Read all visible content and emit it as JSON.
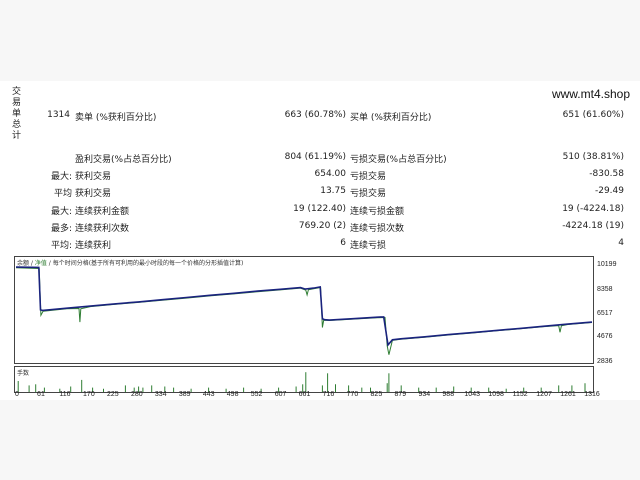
{
  "header": {
    "vertical_title": "交易单总计",
    "site": "www.mt4.shop"
  },
  "stats": {
    "total_trades": "1314",
    "short_label": "卖单 (%获利百分比)",
    "short_value": "663 (60.78%)",
    "long_label": "买单 (%获利百分比)",
    "long_value": "651 (61.60%)",
    "profit_trades_label": "盈利交易(%占总百分比)",
    "profit_trades_value": "804 (61.19%)",
    "loss_trades_label": "亏损交易(%占总百分比)",
    "loss_trades_value": "510 (38.81%)",
    "largest_label": "最大:",
    "largest_profit_label": "获利交易",
    "largest_profit_value": "654.00",
    "largest_loss_label": "亏损交易",
    "largest_loss_value": "-830.58",
    "average_label": "平均",
    "average_profit_label": "获利交易",
    "average_profit_value": "13.75",
    "average_loss_label": "亏损交易",
    "average_loss_value": "-29.49",
    "maximum_label": "最大:",
    "max_consec_win_money_label": "连续获利金额",
    "max_consec_win_money_value": "19 (122.40)",
    "max_consec_loss_money_label": "连续亏损金额",
    "max_consec_loss_money_value": "19 (-4224.18)",
    "maximal_label": "最多:",
    "max_consec_win_count_label": "连续获利次数",
    "max_consec_win_count_value": "769.20 (2)",
    "max_consec_loss_count_label": "连续亏损次数",
    "max_consec_loss_count_value": "-4224.18 (19)",
    "avg_consec_label": "平均:",
    "avg_consec_win_label": "连续获利",
    "avg_consec_win_value": "6",
    "avg_consec_loss_label": "连续亏损",
    "avg_consec_loss_value": "4"
  },
  "chart_data": {
    "type": "line",
    "legend_balance": "余额",
    "legend_equity": "净值",
    "legend_text": "每个时间分格(基于所有可利用的最小时段的每一个价格的分形插值计算)",
    "volume_label": "手数",
    "y_ticks": [
      "10199",
      "8358",
      "6517",
      "4676",
      "2836"
    ],
    "ylim": [
      2836,
      10199
    ],
    "x_ticks": [
      "0",
      "61",
      "116",
      "170",
      "225",
      "280",
      "334",
      "389",
      "443",
      "498",
      "552",
      "607",
      "661",
      "716",
      "770",
      "825",
      "879",
      "934",
      "988",
      "1043",
      "1098",
      "1152",
      "1207",
      "1261",
      "1316"
    ],
    "xlim": [
      0,
      1316
    ],
    "series": [
      {
        "name": "余额",
        "color": "#1a237e",
        "x": [
          0,
          52,
          56,
          61,
          116,
          170,
          225,
          280,
          334,
          389,
          443,
          498,
          552,
          607,
          650,
          661,
          680,
          695,
          700,
          705,
          716,
          770,
          825,
          840,
          850,
          860,
          879,
          934,
          988,
          1043,
          1098,
          1152,
          1207,
          1261,
          1316
        ],
        "y": [
          9750,
          9730,
          6600,
          6560,
          6720,
          6880,
          7040,
          7190,
          7350,
          7510,
          7670,
          7820,
          7980,
          8120,
          8240,
          8130,
          8200,
          8290,
          5950,
          5880,
          5850,
          5950,
          6060,
          6080,
          4020,
          4400,
          4470,
          4620,
          4780,
          4930,
          5090,
          5240,
          5400,
          5550,
          5700
        ]
      },
      {
        "name": "净值",
        "color": "#2e7d32",
        "x": [
          0,
          53,
          57,
          62,
          116,
          144,
          146,
          148,
          170,
          225,
          280,
          334,
          389,
          443,
          498,
          552,
          607,
          650,
          662,
          665,
          668,
          680,
          696,
          700,
          703,
          716,
          770,
          825,
          843,
          848,
          852,
          860,
          879,
          934,
          988,
          1043,
          1098,
          1152,
          1207,
          1240,
          1243,
          1246,
          1261,
          1316
        ],
        "y": [
          9700,
          9650,
          6200,
          6500,
          6680,
          6700,
          5700,
          6680,
          6840,
          7000,
          7150,
          7310,
          7470,
          7630,
          7780,
          7940,
          8080,
          8200,
          8050,
          7700,
          8080,
          8160,
          8250,
          5300,
          5840,
          5820,
          5920,
          6020,
          6040,
          3950,
          3300,
          4350,
          4440,
          4590,
          4750,
          4900,
          5060,
          5210,
          5370,
          5440,
          4950,
          5430,
          5520,
          5670
        ]
      }
    ],
    "volume": {
      "color": "#2e7d32",
      "x": [
        5,
        30,
        45,
        65,
        100,
        125,
        150,
        175,
        200,
        250,
        270,
        280,
        290,
        310,
        340,
        360,
        400,
        440,
        480,
        520,
        560,
        600,
        640,
        655,
        662,
        700,
        712,
        730,
        760,
        790,
        810,
        848,
        852,
        880,
        920,
        960,
        1000,
        1040,
        1080,
        1120,
        1160,
        1200,
        1240,
        1270,
        1300
      ],
      "y": [
        0.5,
        0.3,
        0.35,
        0.2,
        0.15,
        0.25,
        0.55,
        0.2,
        0.15,
        0.3,
        0.2,
        0.25,
        0.2,
        0.3,
        0.25,
        0.2,
        0.15,
        0.2,
        0.15,
        0.2,
        0.15,
        0.2,
        0.25,
        0.35,
        0.9,
        0.3,
        0.85,
        0.35,
        0.3,
        0.2,
        0.2,
        0.4,
        0.85,
        0.3,
        0.2,
        0.2,
        0.25,
        0.2,
        0.2,
        0.15,
        0.2,
        0.2,
        0.3,
        0.3,
        0.4
      ]
    }
  }
}
